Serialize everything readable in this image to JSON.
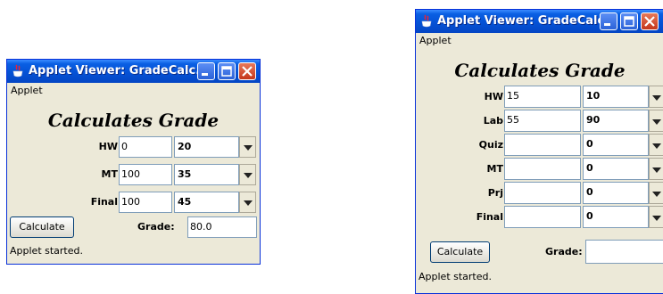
{
  "window1": {
    "title": "Applet Viewer: GradeCalc...",
    "menu": "Applet",
    "heading": "Calculates Grade",
    "rows": [
      {
        "label": "HW",
        "value": "0",
        "weight": "20"
      },
      {
        "label": "MT",
        "value": "100",
        "weight": "35"
      },
      {
        "label": "Final",
        "value": "100",
        "weight": "45"
      }
    ],
    "calculate_label": "Calculate",
    "grade_label": "Grade:",
    "grade_value": "80.0",
    "status": "Applet started."
  },
  "window2": {
    "title": "Applet Viewer: GradeCalc...",
    "menu": "Applet",
    "heading": "Calculates Grade",
    "rows": [
      {
        "label": "HW",
        "value": "15",
        "weight": "10"
      },
      {
        "label": "Lab",
        "value": "55",
        "weight": "90"
      },
      {
        "label": "Quiz",
        "value": "",
        "weight": "0"
      },
      {
        "label": "MT",
        "value": "",
        "weight": "0"
      },
      {
        "label": "Prj",
        "value": "",
        "weight": "0"
      },
      {
        "label": "Final",
        "value": "",
        "weight": "0"
      }
    ],
    "calculate_label": "Calculate",
    "grade_label": "Grade:",
    "grade_value": "",
    "status": "Applet started."
  },
  "icons": {
    "java": "java-cup-icon",
    "minimize": "minimize-icon",
    "maximize": "maximize-icon",
    "close": "close-icon",
    "dropdown": "chevron-down-icon"
  },
  "colors": {
    "title_bar": "#0552d6",
    "window_bg": "#ece9d8",
    "close_button": "#c4361b"
  }
}
